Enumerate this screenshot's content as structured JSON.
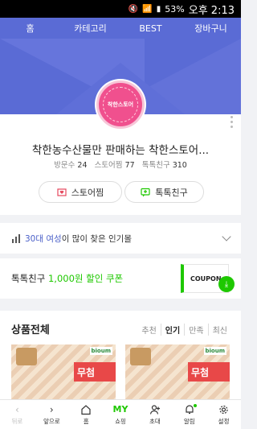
{
  "status": {
    "battery": "53%",
    "time": "오후 2:13"
  },
  "top_nav": {
    "tabs": [
      "홈",
      "카테고리",
      "BEST",
      "장바구니"
    ]
  },
  "store": {
    "logo_text": "착한스토어",
    "name": "착한농수산물만 판매하는 착한스토어...",
    "visits_label": "방문수",
    "visits": "24",
    "favorites_label": "스토어찜",
    "favorites": "77",
    "friends_label": "톡톡친구",
    "friends": "310",
    "fav_button": "스토어찜",
    "friend_button": "톡톡친구"
  },
  "popular": {
    "age": "30대",
    "gender": "여성",
    "rest": "이 많이 찾은 인기몰"
  },
  "coupon": {
    "prefix": "톡톡친구",
    "amount": "1,000원 할인 쿠폰",
    "tag": "COUPON"
  },
  "products": {
    "title": "상품전체",
    "sort": [
      "추천",
      "인기",
      "만족",
      "최신"
    ],
    "active_sort": "인기",
    "thumb_brand": "bioum",
    "thumb_text": "무첨"
  },
  "bottom_bar": {
    "items": [
      "뒤로",
      "앞으로",
      "홈",
      "쇼핑",
      "초대",
      "알림",
      "설정"
    ],
    "my_label": "MY"
  },
  "colors": {
    "nav_blue": "#5a6bd5",
    "naver_green": "#1ec800",
    "logo_pink": "#f0508e"
  }
}
